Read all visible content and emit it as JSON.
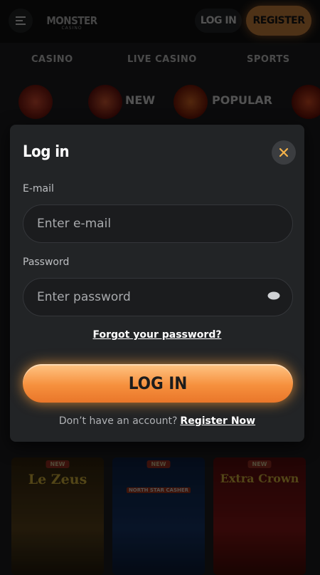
{
  "header": {
    "logo_text": "MONSTER",
    "logo_sub": "CASINO",
    "login_label": "LOG IN",
    "register_label": "REGISTER"
  },
  "nav_tabs": [
    "CASINO",
    "LIVE CASINO",
    "SPORTS"
  ],
  "categories": [
    {
      "label": "",
      "icon": "search-icon"
    },
    {
      "label": "NEW",
      "icon": "lightning-icon"
    },
    {
      "label": "POPULAR",
      "icon": "flame-icon"
    },
    {
      "label": "",
      "icon": "egg-icon"
    }
  ],
  "games": [
    {
      "badge": "NEW",
      "title": "Le Zeus",
      "subtitle": ""
    },
    {
      "badge": "NEW",
      "title": "",
      "subtitle": "NORTH STAR CASHER"
    },
    {
      "badge": "NEW",
      "title": "Extra Crown",
      "subtitle": ""
    }
  ],
  "modal": {
    "title": "Log in",
    "email_label": "E-mail",
    "email_placeholder": "Enter e-mail",
    "password_label": "Password",
    "password_placeholder": "Enter password",
    "forgot_label": "Forgot your password?",
    "submit_label": "LOG IN",
    "no_account_text": "Don’t have an account?",
    "register_link": "Register Now"
  },
  "colors": {
    "accent": "#f39a4a",
    "modal_bg": "#222426",
    "page_bg": "#0d0e0f"
  }
}
